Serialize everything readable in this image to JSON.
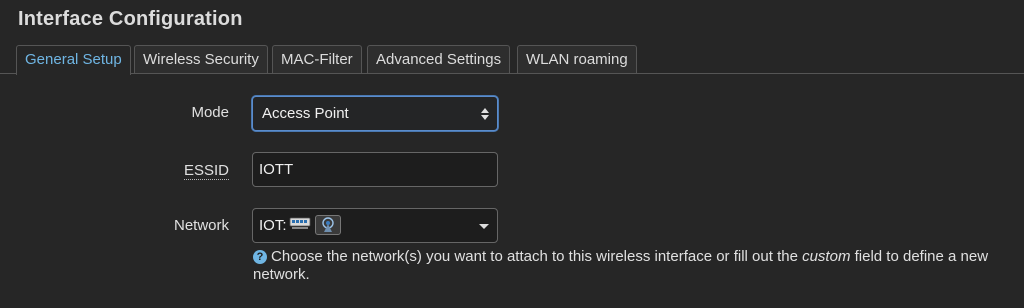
{
  "heading": "Interface Configuration",
  "tabs": [
    {
      "label": "General Setup",
      "active": true
    },
    {
      "label": "Wireless Security",
      "active": false
    },
    {
      "label": "MAC-Filter",
      "active": false
    },
    {
      "label": "Advanced Settings",
      "active": false
    },
    {
      "label": "WLAN roaming",
      "active": false
    }
  ],
  "form": {
    "mode": {
      "label": "Mode",
      "value": "Access Point"
    },
    "essid": {
      "label": "ESSID",
      "value": "IOTT"
    },
    "network": {
      "label": "Network",
      "value": "IOT:",
      "icons": [
        "ethernet-ports-icon",
        "wireless-antenna-icon"
      ]
    }
  },
  "help": {
    "icon": "?",
    "text_before": "Choose the network(s) you want to attach to this wireless interface or fill out the ",
    "emphasis": "custom",
    "text_after": " field to define a new network."
  },
  "colors": {
    "background": "#262626",
    "active_tab": "#6fb5e3",
    "focus_border": "#5a8ccc"
  }
}
